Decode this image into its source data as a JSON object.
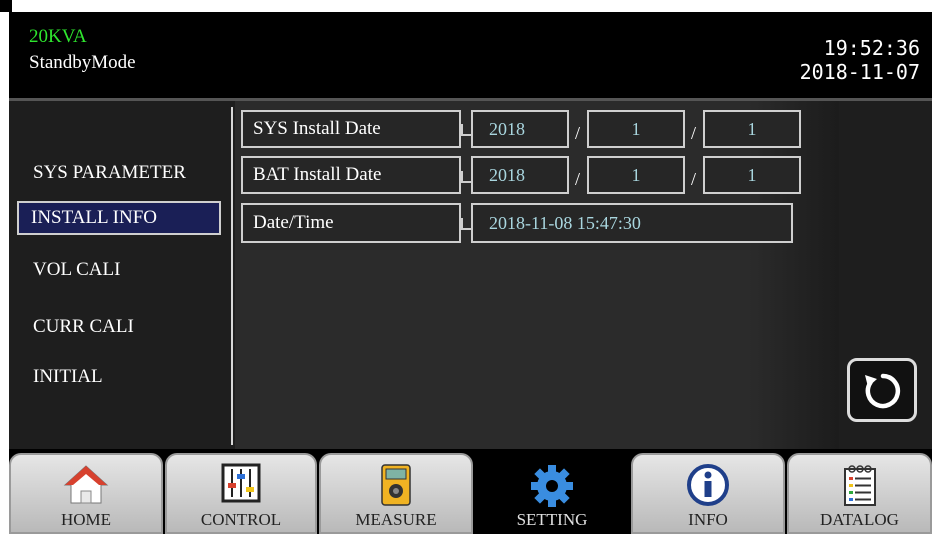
{
  "header": {
    "model": "20KVA",
    "mode": "StandbyMode",
    "time": "19:52:36",
    "date": "2018-11-07"
  },
  "sidebar": {
    "items": [
      {
        "label": "SYS PARAMETER",
        "active": false
      },
      {
        "label": "INSTALL INFO",
        "active": true
      },
      {
        "label": "VOL CALI",
        "active": false
      },
      {
        "label": "CURR CALI",
        "active": false
      },
      {
        "label": "INITIAL",
        "active": false
      }
    ]
  },
  "install": {
    "sys_label": "SYS Install Date",
    "sys_year": "2018",
    "sys_month": "1",
    "sys_day": "1",
    "bat_label": "BAT Install Date",
    "bat_year": "2018",
    "bat_month": "1",
    "bat_day": "1",
    "datetime_label": "Date/Time",
    "datetime_value": "2018-11-08 15:47:30",
    "separator": "/"
  },
  "icons": {
    "back": "refresh-back-icon"
  },
  "nav": {
    "tabs": [
      {
        "label": "HOME",
        "icon": "home-icon"
      },
      {
        "label": "CONTROL",
        "icon": "sliders-icon"
      },
      {
        "label": "MEASURE",
        "icon": "multimeter-icon"
      },
      {
        "label": "SETTING",
        "icon": "gear-icon",
        "active": true
      },
      {
        "label": "INFO",
        "icon": "info-icon"
      },
      {
        "label": "DATALOG",
        "icon": "notepad-icon"
      }
    ]
  },
  "colors": {
    "model_text": "#2ee62e",
    "value_text": "#a9d6df",
    "active_item_bg": "#1a1f56",
    "gear": "#3a8de0"
  }
}
